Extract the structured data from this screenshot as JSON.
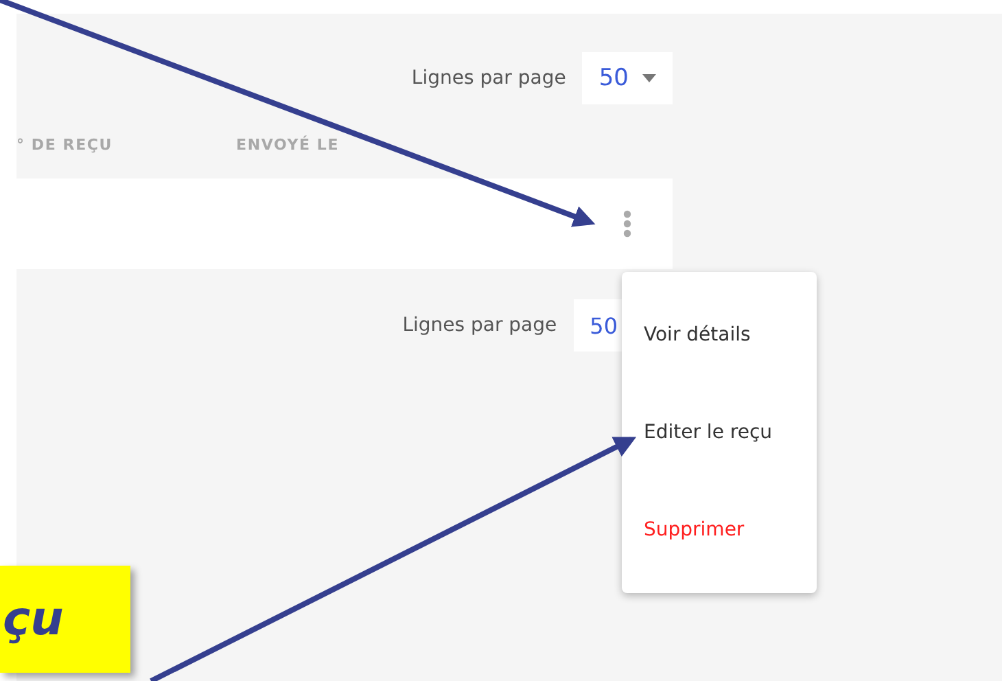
{
  "pagination_top": {
    "label": "Lignes par page",
    "value": "50"
  },
  "table": {
    "columns": [
      "° DE REÇU",
      "ENVOYÉ LE"
    ]
  },
  "pagination_bottom": {
    "label": "Lignes par page",
    "value": "50"
  },
  "menu": {
    "items": [
      {
        "label": "Voir détails",
        "kind": "normal"
      },
      {
        "label": "Editer le reçu",
        "kind": "normal"
      },
      {
        "label": "Supprimer",
        "kind": "danger"
      }
    ]
  },
  "callout": {
    "text": "çu"
  }
}
